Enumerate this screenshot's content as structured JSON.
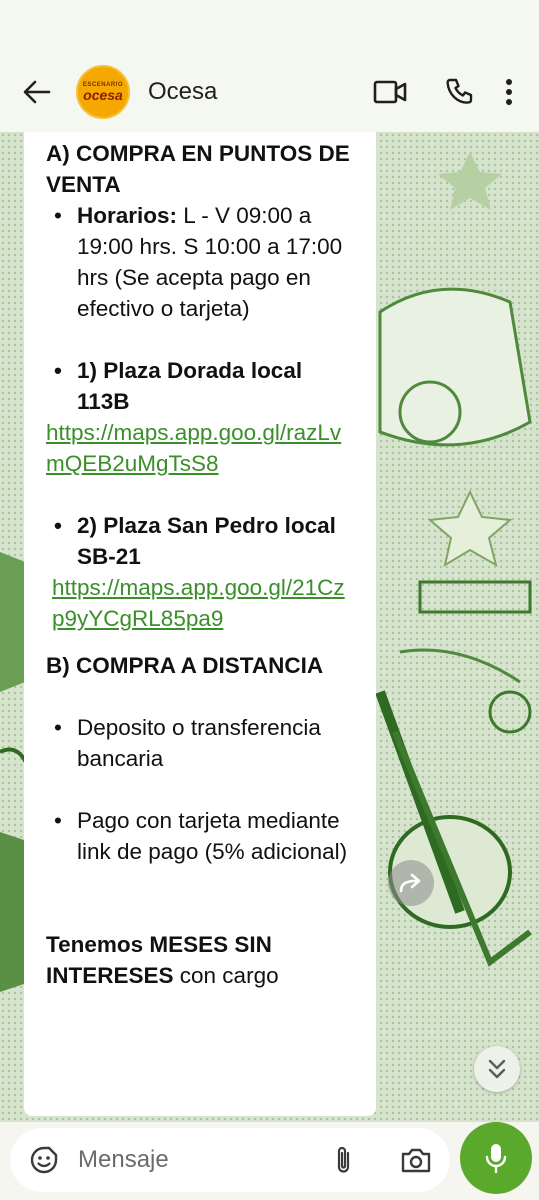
{
  "header": {
    "contact_name": "Ocesa",
    "avatar_top_text": "ESCENARIO",
    "avatar_main_text": "ocesa",
    "icons": [
      "back-arrow-icon",
      "video-call-icon",
      "phone-icon",
      "more-vert-icon"
    ]
  },
  "message": {
    "section_a_heading": "A) COMPRA EN PUNTOS DE VENTA",
    "hours_label": "Horarios:",
    "hours_text": " L - V 09:00 a 19:00 hrs. S 10:00 a 17:00 hrs (Se acepta pago en efectivo o tarjeta)",
    "store1_name": "1) Plaza Dorada local 113B",
    "store1_link": "https://maps.app.goo.gl/razLvmQEB2uMgTsS8",
    "store2_name": "2) Plaza San Pedro local SB-21",
    "store2_link": "https://maps.app.goo.gl/21Czp9yYCgRL85pa9",
    "section_b_heading": "B) COMPRA A DISTANCIA",
    "option1": "Deposito o transferencia bancaria",
    "option2": "Pago con tarjeta mediante link de pago (5% adicional)",
    "footer_bold": "Tenemos MESES SIN INTERESES",
    "footer_rest": " con cargo"
  },
  "composer": {
    "placeholder": "Mensaje",
    "icons": [
      "emoji-icon",
      "attach-icon",
      "camera-icon",
      "mic-icon"
    ]
  },
  "colors": {
    "link": "#3b8f2a",
    "mic_button": "#5aa82c",
    "header_bg": "#f5f7f1",
    "wallpaper": "#c9dcc0"
  }
}
